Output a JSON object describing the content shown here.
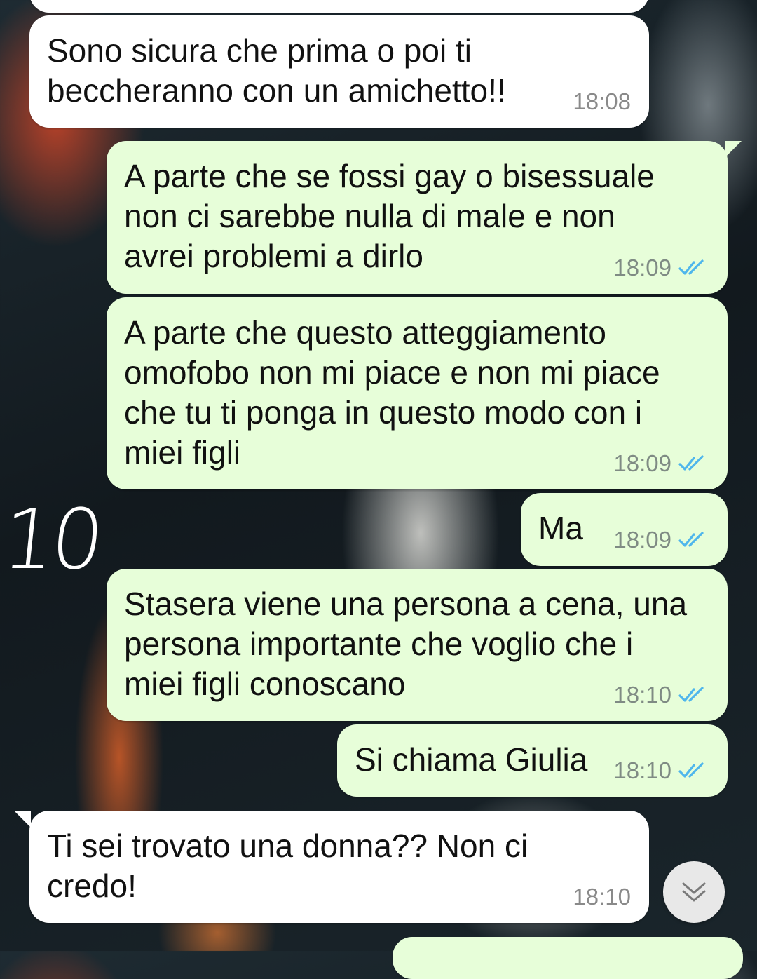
{
  "messages": [
    {
      "dir": "in",
      "text": "Sono sicura che prima o poi ti\nbeccheranno con un amichetto!!",
      "time": "18:08"
    },
    {
      "dir": "out",
      "text": "A parte che se fossi gay o bisessuale\nnon ci sarebbe nulla di male e non\navrei problemi a dirlo",
      "time": "18:09"
    },
    {
      "dir": "out",
      "text": "A parte che questo atteggiamento\nomofobo non mi piace e non mi piace\nche tu ti ponga in questo modo con i\nmiei figli",
      "time": "18:09"
    },
    {
      "dir": "out",
      "text": "Ma",
      "time": "18:09"
    },
    {
      "dir": "out",
      "text": "Stasera viene una persona a cena, una\npersona importante che voglio che i\nmiei figli conoscano",
      "time": "18:10"
    },
    {
      "dir": "out",
      "text": "Si chiama Giulia",
      "time": "18:10"
    },
    {
      "dir": "in",
      "text": "Ti sei trovato una donna?? Non ci\ncredo!",
      "time": "18:10"
    }
  ],
  "annotation": "10",
  "colors": {
    "incoming_bubble": "#ffffff",
    "outgoing_bubble": "#e7fed9",
    "read_ticks": "#4fb6ec"
  },
  "icons": {
    "read_receipt": "double-check-icon",
    "scroll_down": "double-chevron-down-icon"
  }
}
